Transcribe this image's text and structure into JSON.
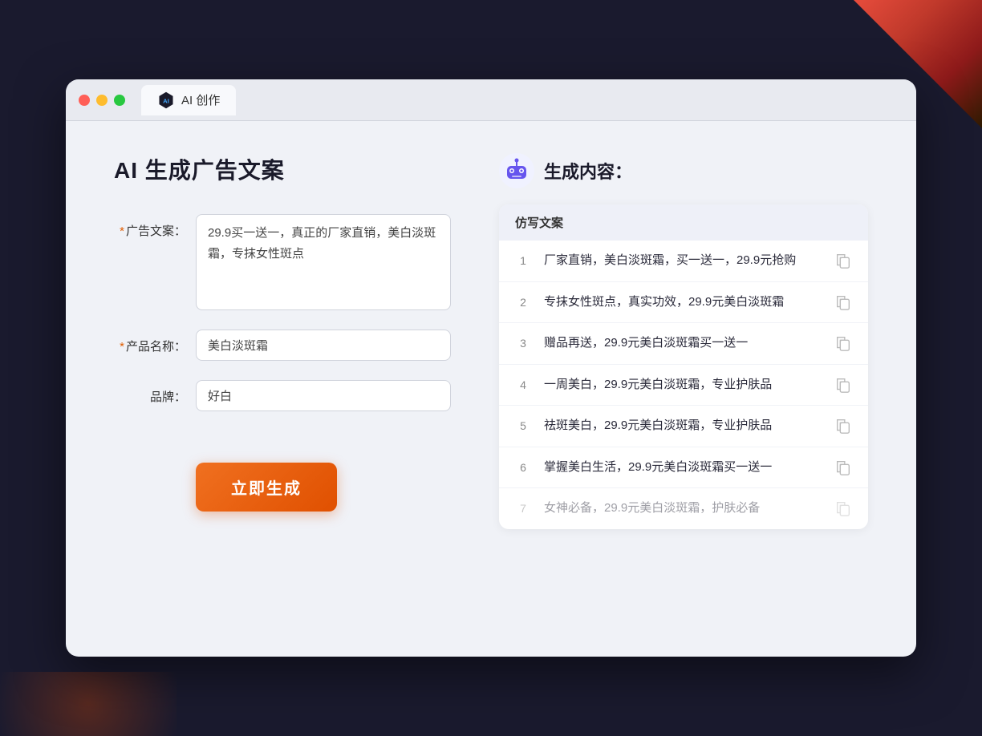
{
  "window": {
    "tab_label": "AI 创作"
  },
  "page": {
    "title": "AI 生成广告文案"
  },
  "form": {
    "ad_copy_label": "广告文案：",
    "ad_copy_required": "*",
    "ad_copy_value": "29.9买一送一，真正的厂家直销，美白淡斑霜，专抹女性斑点",
    "product_name_label": "产品名称：",
    "product_name_required": "*",
    "product_name_value": "美白淡斑霜",
    "brand_label": "品牌：",
    "brand_value": "好白",
    "generate_button": "立即生成"
  },
  "results": {
    "header_icon": "robot",
    "header_title": "生成内容：",
    "column_label": "仿写文案",
    "items": [
      {
        "id": 1,
        "text": "厂家直销，美白淡斑霜，买一送一，29.9元抢购",
        "faded": false
      },
      {
        "id": 2,
        "text": "专抹女性斑点，真实功效，29.9元美白淡斑霜",
        "faded": false
      },
      {
        "id": 3,
        "text": "赠品再送，29.9元美白淡斑霜买一送一",
        "faded": false
      },
      {
        "id": 4,
        "text": "一周美白，29.9元美白淡斑霜，专业护肤品",
        "faded": false
      },
      {
        "id": 5,
        "text": "祛斑美白，29.9元美白淡斑霜，专业护肤品",
        "faded": false
      },
      {
        "id": 6,
        "text": "掌握美白生活，29.9元美白淡斑霜买一送一",
        "faded": false
      },
      {
        "id": 7,
        "text": "女神必备，29.9元美白淡斑霜，护肤必备",
        "faded": true
      }
    ]
  }
}
